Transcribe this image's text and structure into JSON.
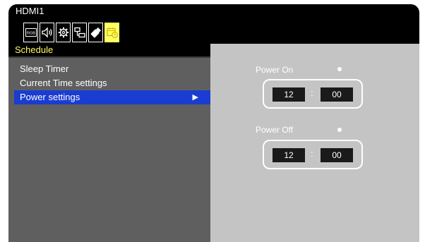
{
  "source": "HDMI1",
  "icons": [
    {
      "name": "rgb-picture-icon",
      "label": "RGB",
      "active": false
    },
    {
      "name": "speaker-icon",
      "active": false
    },
    {
      "name": "gear-icon",
      "active": false
    },
    {
      "name": "network-icon",
      "active": false
    },
    {
      "name": "usb-icon",
      "active": false
    },
    {
      "name": "schedule-icon",
      "active": true
    }
  ],
  "section_title": "Schedule",
  "menu": {
    "items": [
      {
        "label": "Sleep Timer"
      },
      {
        "label": "Current Time settings"
      },
      {
        "label": "Power settings",
        "arrow": "▶"
      }
    ],
    "selected_index": 2
  },
  "power_on": {
    "label": "Power On",
    "hour": "12",
    "minute": "00",
    "separator": ":"
  },
  "power_off": {
    "label": "Power Off",
    "hour": "12",
    "minute": "00",
    "separator": ":"
  },
  "colors": {
    "accent_yellow": "#ffff66",
    "selection_blue": "#1a3cd0",
    "menu_bg": "#5f5f5f",
    "panel_bg": "#c4c4c4"
  }
}
